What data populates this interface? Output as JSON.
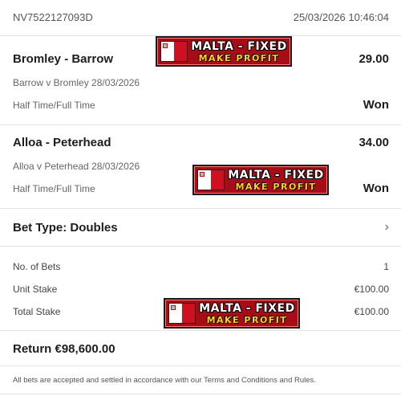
{
  "header": {
    "reference": "NV7522127093D",
    "datetime": "25/03/2026 10:46:04"
  },
  "selections": [
    {
      "title": "Bromley - Barrow",
      "odds": "29.00",
      "event": "Barrow v Bromley 28/03/2026",
      "market": "Half Time/Full Time",
      "result": "Won"
    },
    {
      "title": "Alloa - Peterhead",
      "odds": "34.00",
      "event": "Alloa v Peterhead 28/03/2026",
      "market": "Half Time/Full Time",
      "result": "Won"
    }
  ],
  "bet_type": {
    "label": "Bet Type: Doubles",
    "icon": "chevron-right-icon"
  },
  "stakes": {
    "no_of_bets_label": "No. of Bets",
    "no_of_bets": "1",
    "unit_stake_label": "Unit Stake",
    "unit_stake": "€100.00",
    "total_stake_label": "Total Stake",
    "total_stake": "€100.00"
  },
  "return": {
    "label": "Return €98,600.00"
  },
  "footer": {
    "text": "All bets are accepted and settled in accordance with our Terms and Conditions and Rules."
  },
  "watermark": {
    "line1": "MALTA - FIXED",
    "line2": "MAKE PROFIT",
    "color": "#a70d16",
    "accent": "#ffd21a"
  },
  "colors": {
    "text": "#1d1d1d",
    "muted": "#666666",
    "divider": "#e3e3e3"
  }
}
